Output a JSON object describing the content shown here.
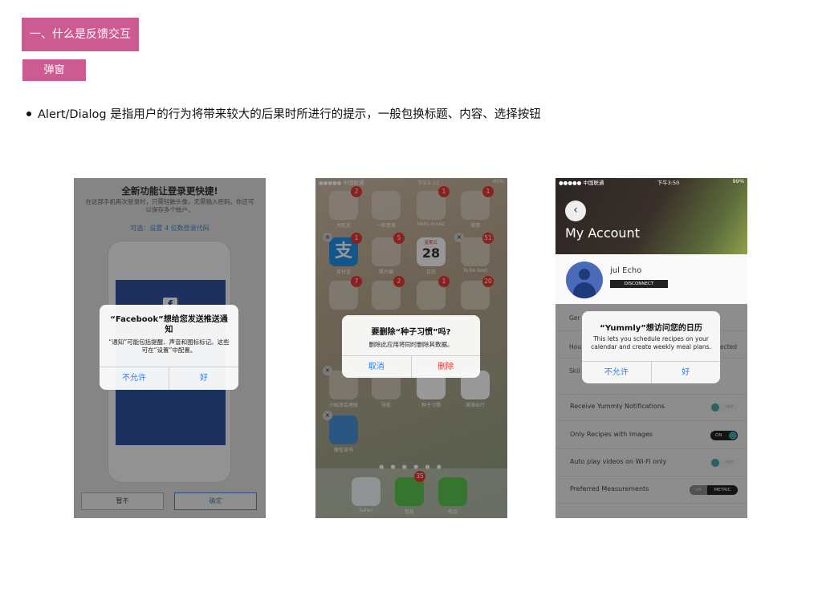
{
  "header": {
    "section_title": "一、什么是反馈交互",
    "subsection_title": "弹窗",
    "description": "Alert/Dialog 是指用户的行为将带来较大的后果时所进行的提示，一般包换标题、内容、选择按钮"
  },
  "screenshot1": {
    "title": "全新功能让登录更快捷!",
    "subtitle": "在这部手机再次登录时，只需轻触头像，无需输入密码。你还可以保存多个帐户。",
    "link": "可选：设置 4 位数登录代码",
    "fb_logo": "f",
    "alert": {
      "title": "“Facebook”想给您发送推送通知",
      "message": "“通知”可能包括提醒、声音和图标标记。这些可在“设置”中配置。",
      "cancel": "不允许",
      "confirm": "好"
    },
    "bottom_left": "暂不",
    "bottom_right": "确定"
  },
  "screenshot2": {
    "status_left": "●●●●● 中国联通",
    "status_time": "下午5:11",
    "status_right": "45%",
    "apps": [
      {
        "label": "大吃货",
        "badge": "2"
      },
      {
        "label": "一秒变美",
        "badge": ""
      },
      {
        "label": "Hello music",
        "badge": "1"
      },
      {
        "label": "常用",
        "badge": "1"
      },
      {
        "label": "支付宝",
        "badge": "1",
        "icon": "支"
      },
      {
        "label": "照片编",
        "badge": "5"
      },
      {
        "label": "日历",
        "badge": "",
        "icon": "28",
        "weekday": "星期五"
      },
      {
        "label": "To be best",
        "badge": "51"
      },
      {
        "label": "",
        "badge": "7"
      },
      {
        "label": "",
        "badge": "2"
      },
      {
        "label": "",
        "badge": "1"
      },
      {
        "label": "",
        "badge": "20"
      },
      {
        "label": "小姑凉会理财",
        "badge": ""
      },
      {
        "label": "导航",
        "badge": ""
      },
      {
        "label": "种子习惯",
        "badge": ""
      },
      {
        "label": "滴滴出行",
        "badge": ""
      },
      {
        "label": "微信读书",
        "badge": ""
      }
    ],
    "dock": [
      {
        "label": "Safari",
        "badge": ""
      },
      {
        "label": "信息",
        "badge": "35"
      },
      {
        "label": "电话",
        "badge": ""
      }
    ],
    "page_dots": "● ● ● ● ● ●",
    "alert": {
      "title": "要删除“种子习惯”吗?",
      "message": "删除此应用将同时删除其数据。",
      "cancel": "取消",
      "delete": "删除"
    }
  },
  "screenshot3": {
    "status_left": "●●●●● 中国联通",
    "status_time": "下午3:50",
    "status_right": "99%",
    "back_icon": "‹",
    "title": "My Account",
    "user_name": "jul Echo",
    "disconnect": "DISCONNECT",
    "peek_left1": "Ger",
    "peek_left2": "Hou",
    "peek_left3": "Skil",
    "peek_right": "ected",
    "rows": [
      {
        "label": "Receive Yummly Notifications",
        "toggle": "OFF"
      },
      {
        "label": "Only Recipes with Images",
        "toggle": "ON"
      },
      {
        "label": "Auto play videos on Wi-Fi only",
        "toggle": "OFF"
      },
      {
        "label": "Preferred Measurements",
        "seg_left": "US",
        "seg_right": "METRIC"
      }
    ],
    "alert": {
      "title": "“Yummly”想访问您的日历",
      "message": "This lets you schedule recipes on your calendar and create weekly meal plans.",
      "cancel": "不允许",
      "confirm": "好"
    }
  },
  "colors": {
    "tag": "#cc5b91",
    "ios_blue": "#2f7cf6",
    "ios_red": "#e53935"
  }
}
